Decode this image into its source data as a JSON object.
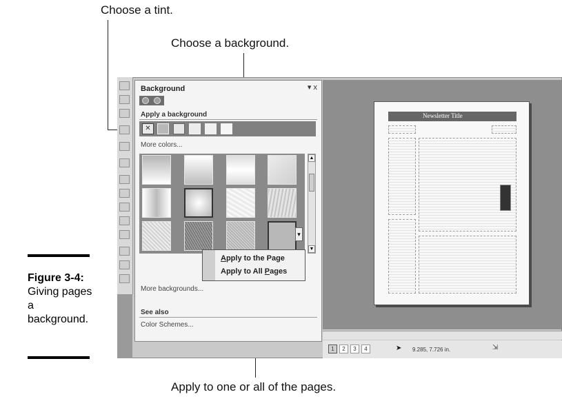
{
  "callouts": {
    "tint": "Choose a tint.",
    "background": "Choose a background.",
    "apply": "Apply to one or all of the pages."
  },
  "figure": {
    "number": "Figure 3-4:",
    "caption": "Giving pages a background."
  },
  "task_pane": {
    "title": "Background",
    "close": "▾ x",
    "apply_section": "Apply a background",
    "more_colors": "More colors...",
    "more_backgrounds": "More backgrounds...",
    "see_also": "See also",
    "color_schemes": "Color Schemes..."
  },
  "context_menu": {
    "items": [
      {
        "underline": "A",
        "rest": "pply to the Page"
      },
      {
        "pre": "Apply to All ",
        "underline": "P",
        "rest": "ages"
      }
    ]
  },
  "document": {
    "title": "Newsletter Title"
  },
  "status_bar": {
    "pages": [
      "1",
      "2",
      "3",
      "4"
    ],
    "coordinates": "9.285, 7.726 in."
  }
}
